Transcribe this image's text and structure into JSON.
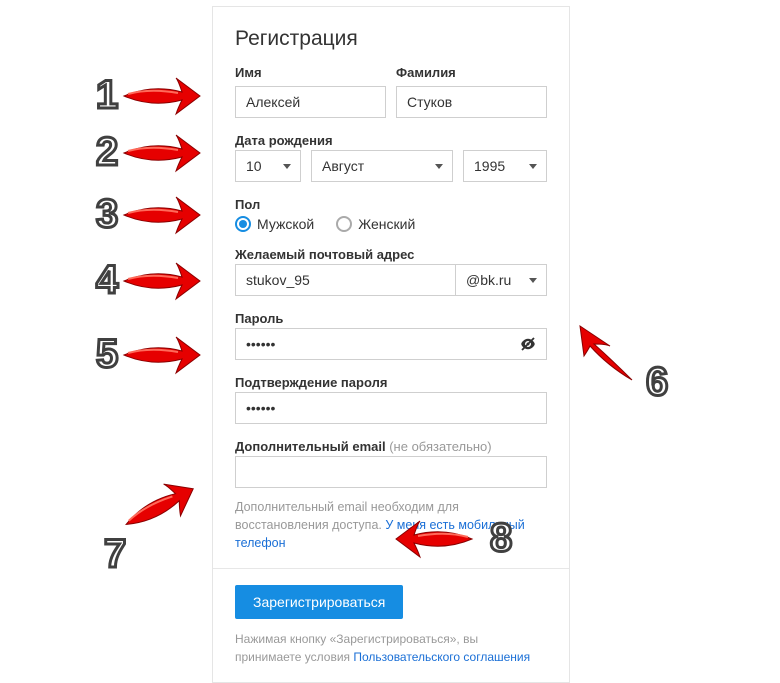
{
  "title": "Регистрация",
  "fields": {
    "firstName": {
      "label": "Имя",
      "value": "Алексей"
    },
    "lastName": {
      "label": "Фамилия",
      "value": "Стуков"
    },
    "dob": {
      "label": "Дата рождения",
      "day": "10",
      "month": "Август",
      "year": "1995"
    },
    "gender": {
      "label": "Пол",
      "male": "Мужской",
      "female": "Женский",
      "selected": "male"
    },
    "email": {
      "label": "Желаемый почтовый адрес",
      "value": "stukov_95",
      "domain": "@bk.ru"
    },
    "password": {
      "label": "Пароль",
      "value": "••••••"
    },
    "passwordConfirm": {
      "label": "Подтверждение пароля",
      "value": "••••••"
    },
    "altEmail": {
      "label": "Дополнительный email",
      "optional": "(не обязательно)",
      "help_prefix": "Дополнительный email необходим для восстановления доступа. ",
      "help_link": "У меня есть мобильный телефон"
    }
  },
  "submit": "Зарегистрироваться",
  "terms_prefix": "Нажимая кнопку «Зарегистрироваться», вы принимаете условия ",
  "terms_link": "Пользовательского соглашения",
  "annotations": {
    "1": "1",
    "2": "2",
    "3": "3",
    "4": "4",
    "5": "5",
    "6": "6",
    "7": "7",
    "8": "8"
  },
  "colors": {
    "accent": "#168de2",
    "arrow": "#e60000"
  }
}
